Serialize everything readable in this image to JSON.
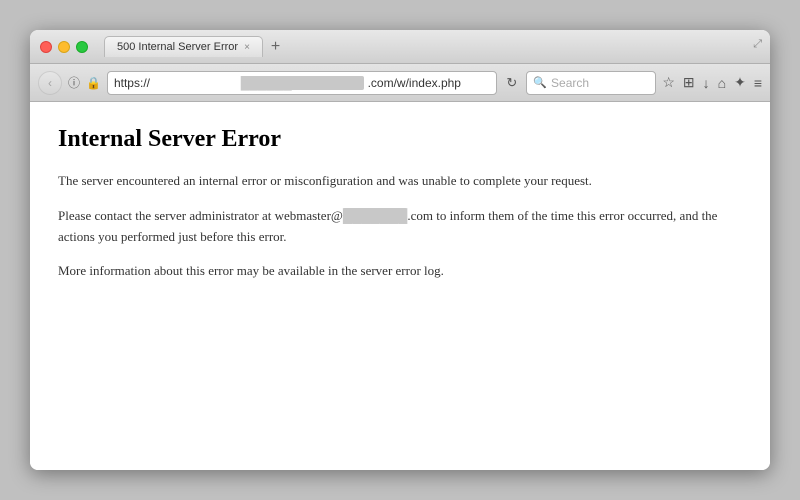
{
  "window": {
    "title": "500 Internal Server Error",
    "tab_close": "×",
    "tab_new": "+",
    "resize": "⤢"
  },
  "controls": {
    "back": "‹",
    "info": "ⓘ",
    "lock": "🔒",
    "refresh": "↻"
  },
  "url_bar": {
    "prefix": "https://",
    "redacted1": "██████",
    "middle": ".com/w/index.php"
  },
  "search": {
    "placeholder": "Search"
  },
  "nav_icons": {
    "star": "☆",
    "bookmark": "⊞",
    "download": "↓",
    "home": "⌂",
    "tools": "✦",
    "menu": "≡"
  },
  "page": {
    "heading": "Internal Server Error",
    "paragraph1": "The server encountered an internal error or misconfiguration and was unable to complete your request.",
    "paragraph2_prefix": "Please contact the server administrator at webmaster@",
    "paragraph2_redacted": "███████",
    "paragraph2_suffix": ".com to inform them of the time this error occurred, and the actions you performed just before this error.",
    "paragraph3": "More information about this error may be available in the server error log."
  }
}
